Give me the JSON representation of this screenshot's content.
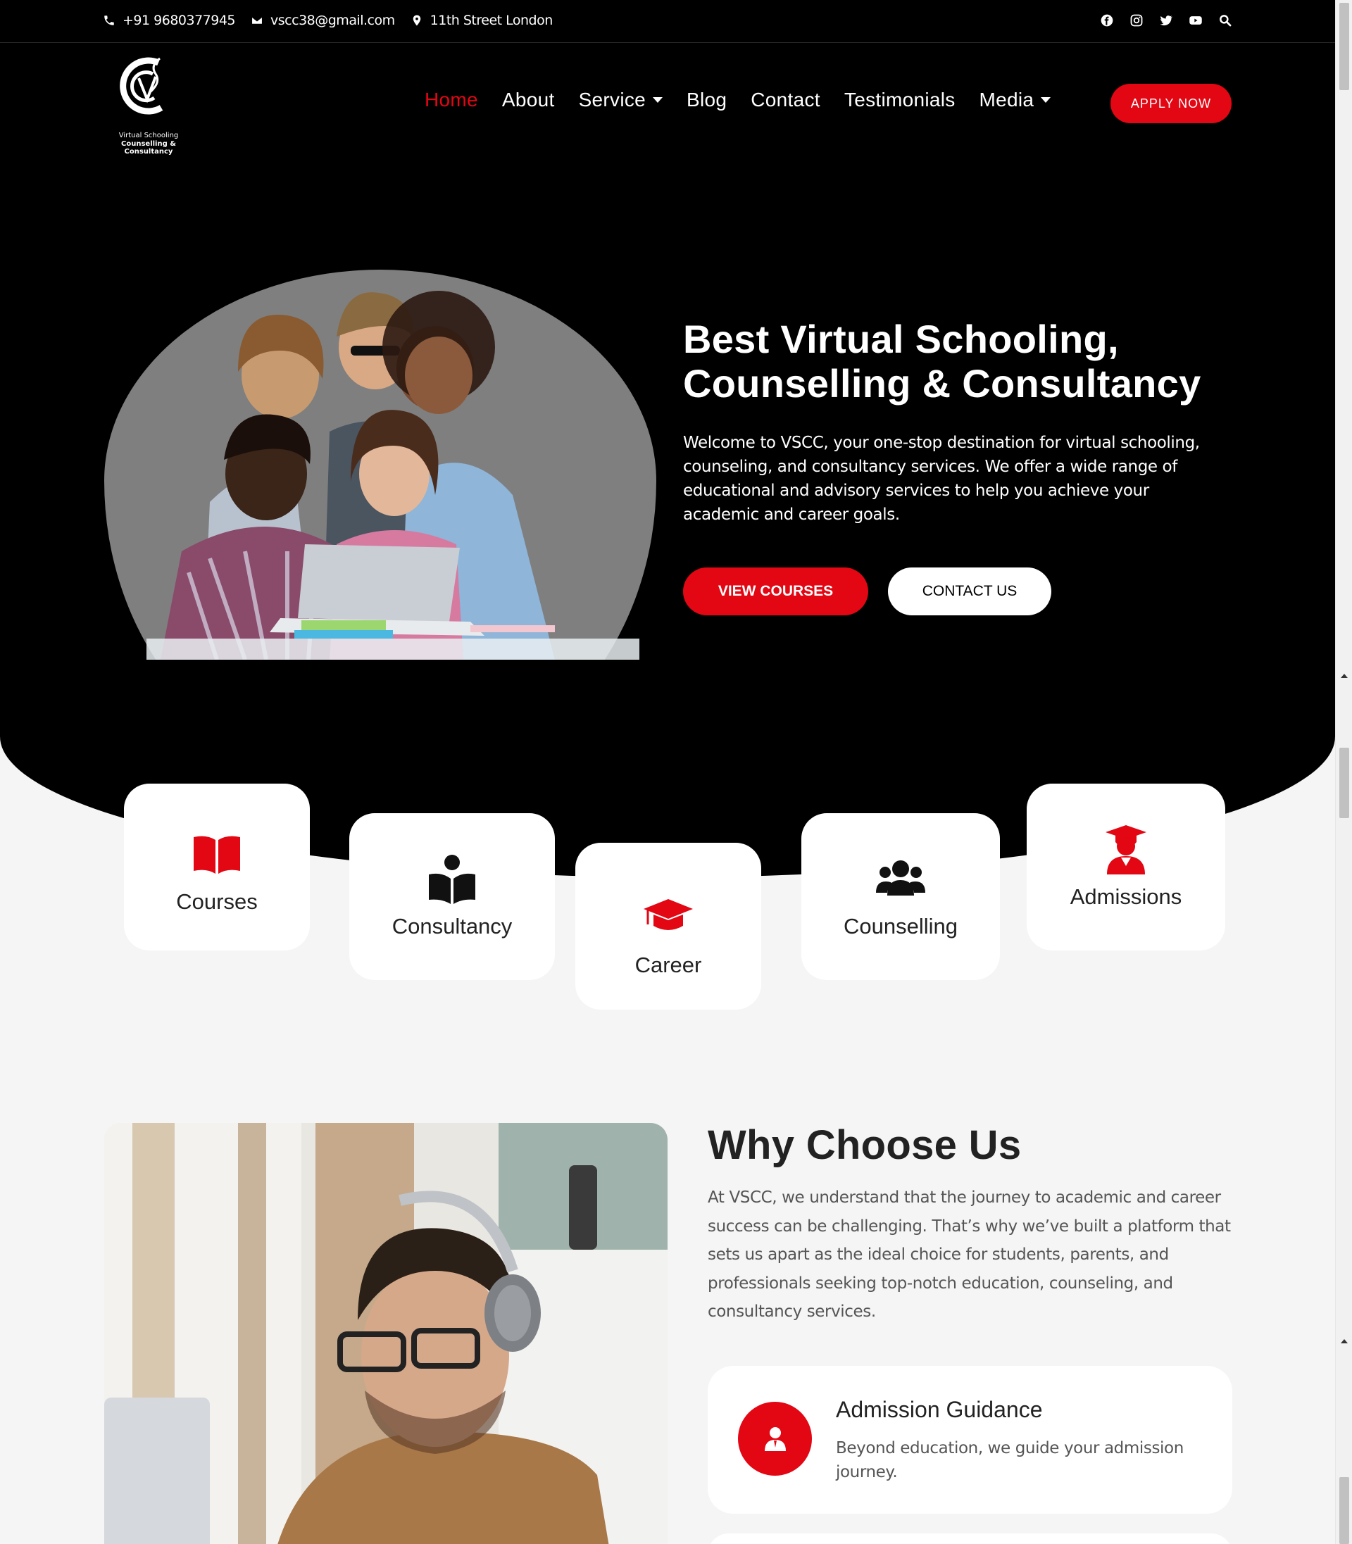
{
  "topbar": {
    "phone": "+91 9680377945",
    "email": "vscc38@gmail.com",
    "address": "11th Street London",
    "socials": [
      "facebook-icon",
      "instagram-icon",
      "twitter-icon",
      "youtube-icon",
      "search-icon"
    ]
  },
  "logo": {
    "line1": "Virtual Schooling",
    "line2": "Counselling & Consultancy"
  },
  "nav": {
    "items": [
      {
        "label": "Home",
        "active": true
      },
      {
        "label": "About"
      },
      {
        "label": "Service",
        "dropdown": true
      },
      {
        "label": "Blog"
      },
      {
        "label": "Contact"
      },
      {
        "label": "Testimonials"
      },
      {
        "label": "Media",
        "dropdown": true
      }
    ],
    "apply_label": "APPLY NOW"
  },
  "hero": {
    "title_line1": "Best Virtual Schooling,",
    "title_line2": "Counselling & Consultancy",
    "text": "Welcome to VSCC, your one-stop destination for virtual schooling, counseling, and consultancy services. We offer a wide range of educational and advisory services to help you achieve your academic and career goals.",
    "primary_button": "VIEW COURSES",
    "secondary_button": "CONTACT US"
  },
  "cards": [
    {
      "label": "Courses",
      "icon": "book-open-icon"
    },
    {
      "label": "Consultancy",
      "icon": "book-reader-icon"
    },
    {
      "label": "Career",
      "icon": "graduation-cap-icon"
    },
    {
      "label": "Counselling",
      "icon": "users-icon"
    },
    {
      "label": "Admissions",
      "icon": "user-graduate-icon"
    }
  ],
  "why": {
    "title": "Why Choose Us",
    "text": "At VSCC, we understand that the journey to academic and career success can be challenging. That’s why we’ve built a platform that sets us apart as the ideal choice for students, parents, and professionals seeking top-notch education, counseling, and consultancy services.",
    "features": [
      {
        "title": "Admission Guidance",
        "text": "Beyond education, we guide your admission journey.",
        "icon": "user-tie-icon"
      }
    ]
  },
  "colors": {
    "accent": "#e30613",
    "dark": "#000000",
    "background": "#f5f5f5"
  }
}
